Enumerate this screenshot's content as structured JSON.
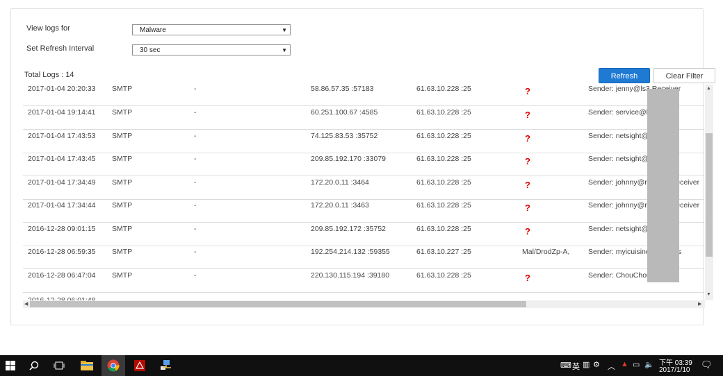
{
  "form": {
    "view_logs_label": "View logs for",
    "view_logs_value": "Malware",
    "refresh_label": "Set Refresh Interval",
    "refresh_value": "30 sec"
  },
  "total_logs": "Total Logs : 14",
  "buttons": {
    "refresh": "Refresh",
    "clear_filter": "Clear Filter"
  },
  "rows": [
    {
      "date": "2017-01-04 20:20:33",
      "proto": "SMTP",
      "dash": "-",
      "src": "58.86.57.35 :57183",
      "dst": "61.63.10.228 :25",
      "virus": "?",
      "detail": "Sender: jenny@ls3                Receiver"
    },
    {
      "date": "2017-01-04 19:14:41",
      "proto": "SMTP",
      "dash": "-",
      "src": "60.251.100.67 :4585",
      "dst": "61.63.10.228 :25",
      "virus": "?",
      "detail": "Sender: service@b               m.tw Re"
    },
    {
      "date": "2017-01-04 17:43:53",
      "proto": "SMTP",
      "dash": "-",
      "src": "74.125.83.53 :35752",
      "dst": "61.63.10.228 :25",
      "virus": "?",
      "detail": "Sender: netsight@                o Receiv"
    },
    {
      "date": "2017-01-04 17:43:45",
      "proto": "SMTP",
      "dash": "-",
      "src": "209.85.192.170 :33079",
      "dst": "61.63.10.228 :25",
      "virus": "?",
      "detail": "Sender: netsight@                o Receiv"
    },
    {
      "date": "2017-01-04 17:34:49",
      "proto": "SMTP",
      "dash": "-",
      "src": "172.20.0.11 :3464",
      "dst": "61.63.10.228 :25",
      "virus": "?",
      "detail": "Sender: johnny@nb             com Receiver"
    },
    {
      "date": "2017-01-04 17:34:44",
      "proto": "SMTP",
      "dash": "-",
      "src": "172.20.0.11 :3463",
      "dst": "61.63.10.228 :25",
      "virus": "?",
      "detail": "Sender: johnny@nb             com Receiver"
    },
    {
      "date": "2016-12-28 09:01:15",
      "proto": "SMTP",
      "dash": "-",
      "src": "209.85.192.172 :35752",
      "dst": "61.63.10.228 :25",
      "virus": "?",
      "detail": "Sender: netsight@                o Receiv"
    },
    {
      "date": "2016-12-28 06:59:35",
      "proto": "SMTP",
      "dash": "-",
      "src": "192.254.214.132 :59355",
      "dst": "61.63.10.227 :25",
      "virus": "Mal/DrodZp-A,",
      "detail": "Sender: myicuisine            mentools"
    },
    {
      "date": "2016-12-28 06:47:04",
      "proto": "SMTP",
      "dash": "-",
      "src": "220.130.115.194 :39180",
      "dst": "61.63.10.228 :25",
      "virus": "?",
      "detail": "Sender: ChouChou              om Rec"
    }
  ],
  "taskbar": {
    "ime": "英",
    "time": "下午 03:39",
    "date": "2017/1/10"
  }
}
